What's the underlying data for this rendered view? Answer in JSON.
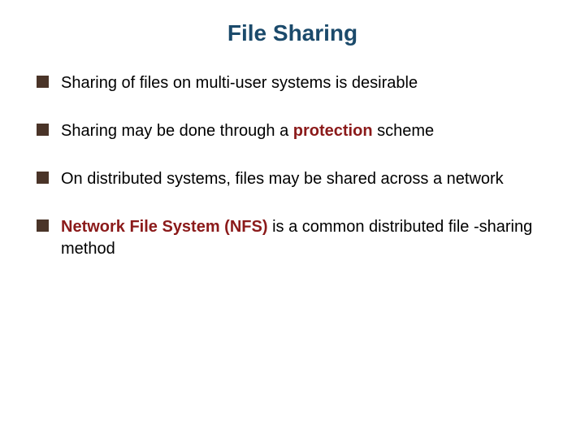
{
  "title": "File Sharing",
  "bullets": {
    "b0": "Sharing of files on multi-user systems is desirable",
    "b1_pre": "Sharing may be done through a ",
    "b1_em": "protection",
    "b1_post": " scheme",
    "b2": "On distributed systems, files may be shared across a network",
    "b3_pre": "",
    "b3_em": "Network File System (NFS)",
    "b3_post": " is a common distributed file -sharing method"
  }
}
